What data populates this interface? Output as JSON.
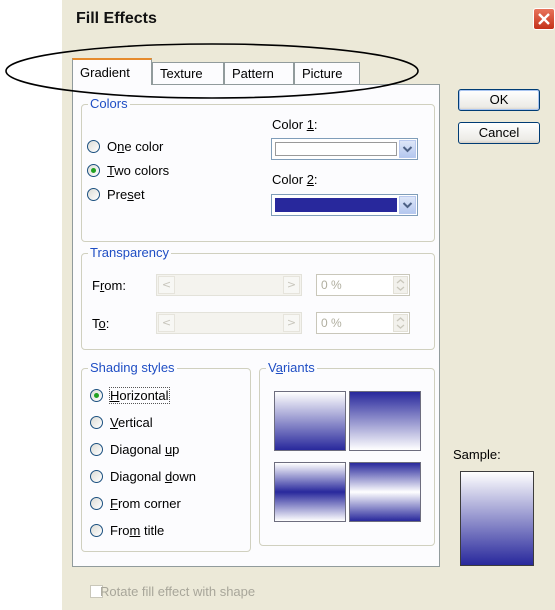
{
  "dialog": {
    "title": "Fill Effects",
    "close_icon": "close-icon",
    "tabs": [
      {
        "label": "Gradient",
        "active": true
      },
      {
        "label": "Texture",
        "active": false
      },
      {
        "label": "Pattern",
        "active": false
      },
      {
        "label": "Picture",
        "active": false
      }
    ],
    "buttons": {
      "ok": "OK",
      "cancel": "Cancel"
    },
    "sample_label": "Sample:"
  },
  "colors_group": {
    "label": "Colors",
    "options": [
      {
        "pre": "O",
        "u": "n",
        "post": "e color",
        "selected": false
      },
      {
        "pre": "",
        "u": "T",
        "post": "wo colors",
        "selected": true
      },
      {
        "pre": "Pre",
        "u": "s",
        "post": "et",
        "selected": false
      }
    ],
    "color1": {
      "pre": "Color ",
      "u": "1",
      "post": ":",
      "value": "#ffffff"
    },
    "color2": {
      "pre": "Color ",
      "u": "2",
      "post": ":",
      "value": "#28289c"
    }
  },
  "transparency_group": {
    "label": "Transparency",
    "from": {
      "pre": "F",
      "u": "r",
      "post": "om:",
      "value": "0 %"
    },
    "to": {
      "pre": "T",
      "u": "o",
      "post": ":",
      "value": "0 %"
    }
  },
  "shading_group": {
    "label": "Shading styles",
    "options": [
      {
        "pre": "",
        "u": "H",
        "post": "orizontal",
        "selected": true
      },
      {
        "pre": "",
        "u": "V",
        "post": "ertical",
        "selected": false
      },
      {
        "pre": "Diagonal ",
        "u": "u",
        "post": "p",
        "selected": false
      },
      {
        "pre": "Diagonal ",
        "u": "d",
        "post": "own",
        "selected": false
      },
      {
        "pre": "",
        "u": "F",
        "post": "rom corner",
        "selected": false
      },
      {
        "pre": "Fro",
        "u": "m",
        "post": " title",
        "selected": false
      }
    ]
  },
  "variants_group": {
    "label": "Variants",
    "pre": "",
    "u": "a",
    "post": "riants",
    "first": "V"
  },
  "rotate_checkbox": {
    "label": "Rotate fill effect with shape",
    "checked": false,
    "enabled": false
  },
  "colors": {
    "accent_tab": "#e68b2c",
    "group_label": "#1f4ec4",
    "gradient_dark": "#28289c"
  }
}
